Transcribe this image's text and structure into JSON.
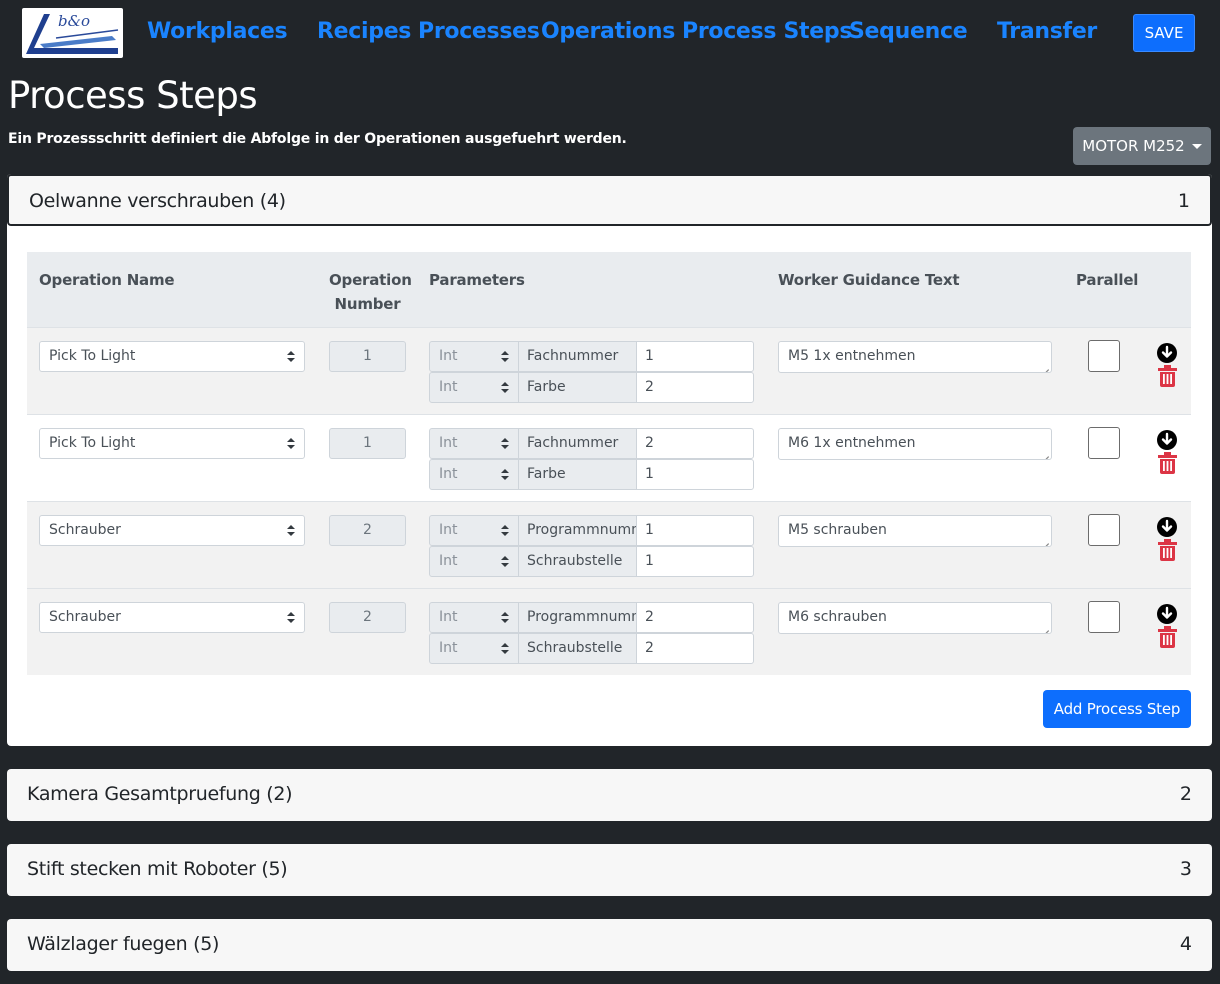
{
  "nav": {
    "logo_text": "b&o",
    "links": [
      "Workplaces",
      "Recipes",
      "Processes",
      "Operations",
      "Process Steps",
      "Sequence",
      "Transfer"
    ],
    "save_label": "SAVE"
  },
  "page": {
    "title": "Process Steps",
    "subtitle": "Ein Prozessschritt definiert die Abfolge in der Operationen ausgefuehrt werden.",
    "product_select": "MOTOR M252"
  },
  "accordion": [
    {
      "title": "Oelwanne verschrauben (4)",
      "index": "1",
      "expanded": true
    },
    {
      "title": "Kamera Gesamtpruefung (2)",
      "index": "2",
      "expanded": false
    },
    {
      "title": "Stift stecken mit Roboter (5)",
      "index": "3",
      "expanded": false
    },
    {
      "title": "Wälzlager fuegen (5)",
      "index": "4",
      "expanded": false
    }
  ],
  "table": {
    "headers": {
      "operation_name": "Operation Name",
      "operation_number_1": "Operation",
      "operation_number_2": "Number",
      "parameters": "Parameters",
      "guidance": "Worker Guidance Text",
      "parallel": "Parallel"
    },
    "rows": [
      {
        "operation": "Pick To Light",
        "number": "1",
        "params": [
          {
            "type": "Int",
            "name": "Fachnummer",
            "value": "1"
          },
          {
            "type": "Int",
            "name": "Farbe",
            "value": "2"
          }
        ],
        "guidance": "M5 1x entnehmen",
        "parallel": false
      },
      {
        "operation": "Pick To Light",
        "number": "1",
        "params": [
          {
            "type": "Int",
            "name": "Fachnummer",
            "value": "2"
          },
          {
            "type": "Int",
            "name": "Farbe",
            "value": "1"
          }
        ],
        "guidance": "M6 1x entnehmen",
        "parallel": false
      },
      {
        "operation": "Schrauber",
        "number": "2",
        "params": [
          {
            "type": "Int",
            "name": "Programmnummer",
            "value": "1"
          },
          {
            "type": "Int",
            "name": "Schraubstelle",
            "value": "1"
          }
        ],
        "guidance": "M5 schrauben",
        "parallel": false
      },
      {
        "operation": "Schrauber",
        "number": "2",
        "params": [
          {
            "type": "Int",
            "name": "Programmnummer",
            "value": "2"
          },
          {
            "type": "Int",
            "name": "Schraubstelle",
            "value": "2"
          }
        ],
        "guidance": "M6 schrauben",
        "parallel": false
      }
    ]
  },
  "add_step_label": "Add Process Step",
  "colors": {
    "background": "#212529",
    "link": "#1a84ff",
    "primary": "#0d6efd",
    "secondary": "#6c757d",
    "delete": "#dc3545"
  }
}
